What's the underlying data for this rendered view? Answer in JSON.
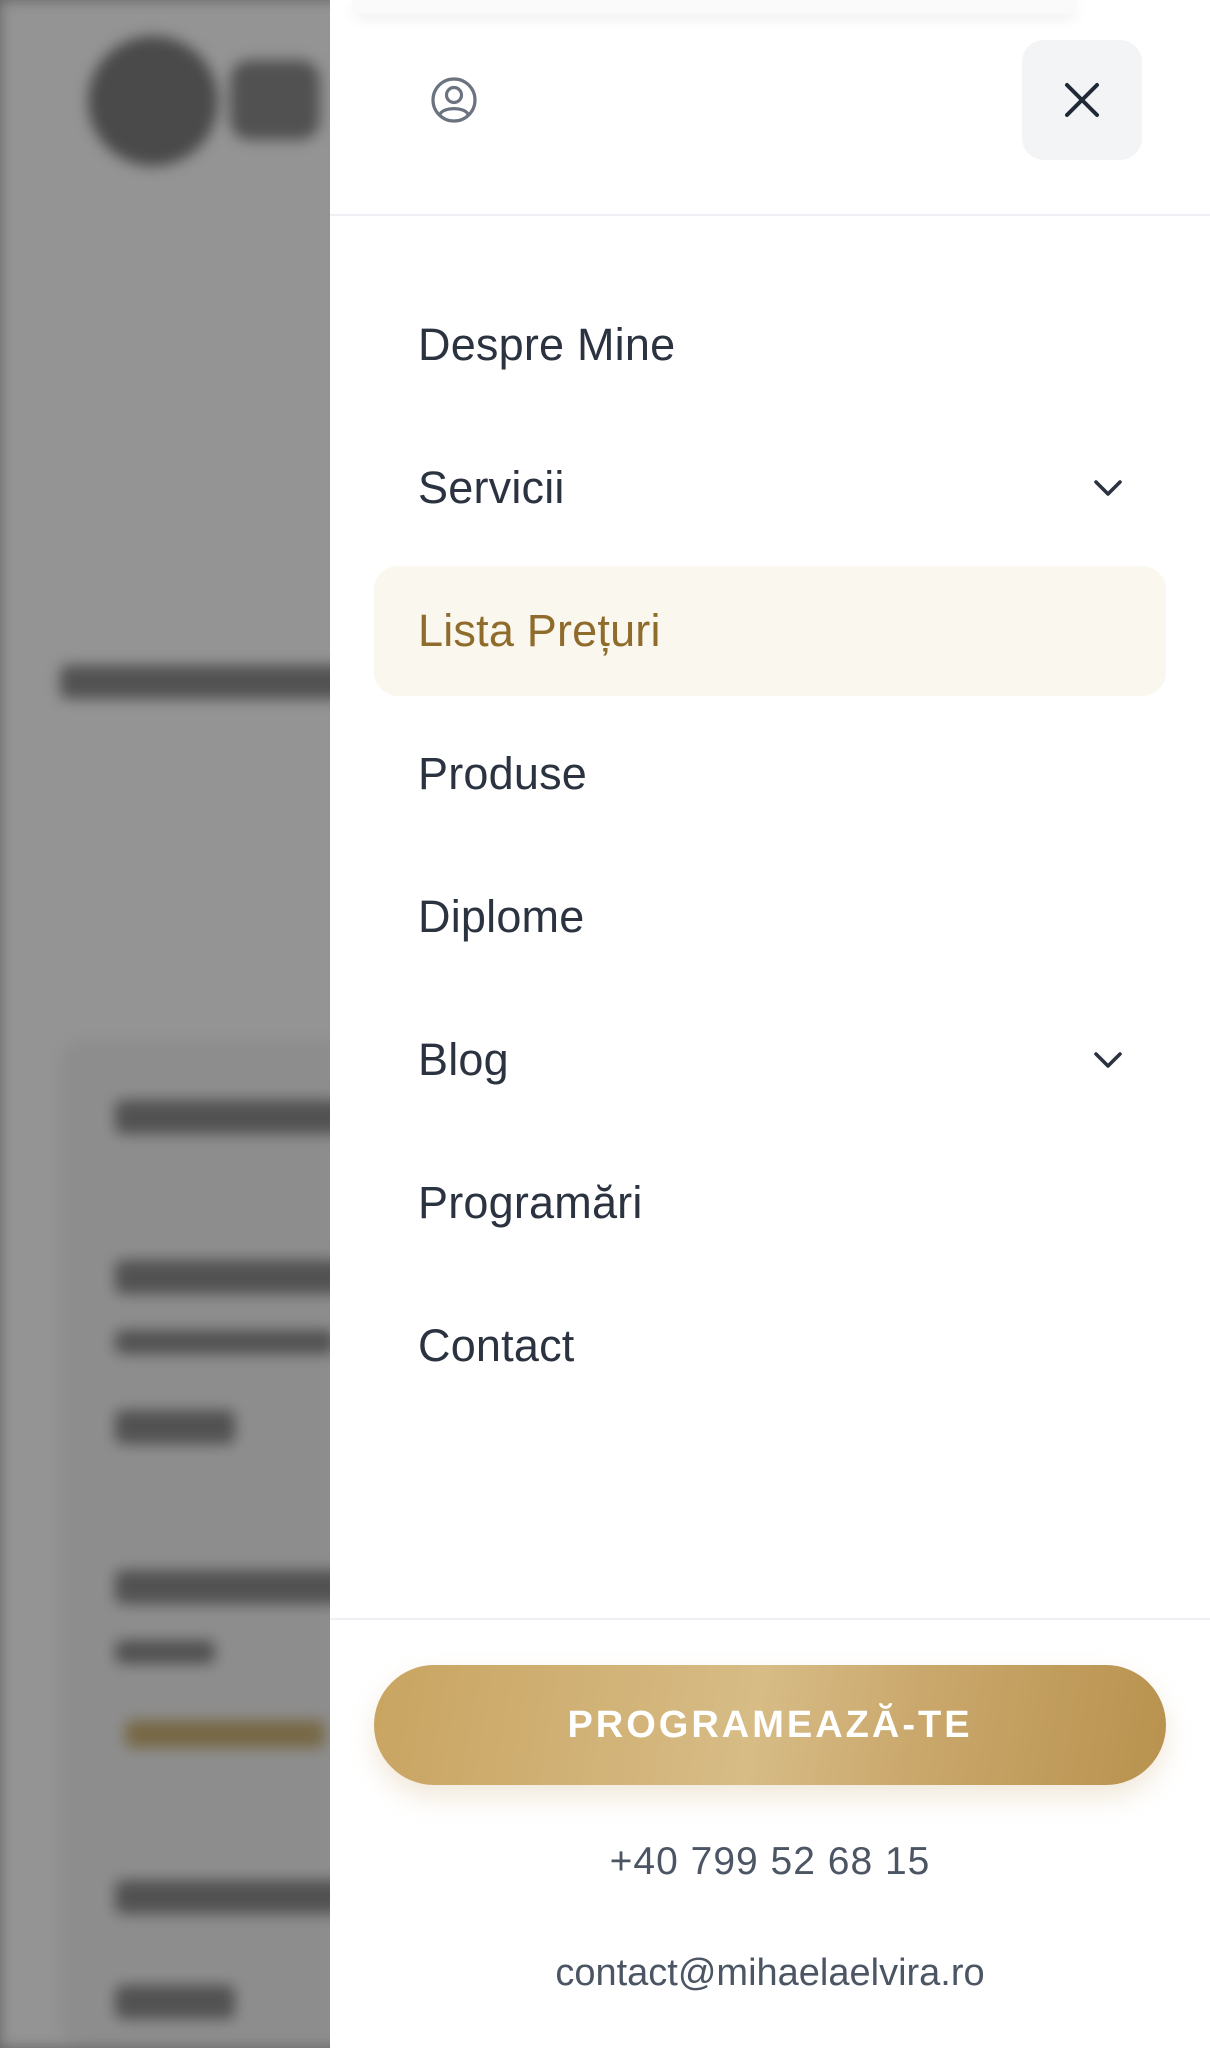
{
  "drawer": {
    "user_icon": "user-circle-icon",
    "close_icon": "close-icon",
    "nav_items": [
      {
        "label": "Despre Mine",
        "has_dropdown": false,
        "active": false
      },
      {
        "label": "Servicii",
        "has_dropdown": true,
        "active": false
      },
      {
        "label": "Lista Prețuri",
        "has_dropdown": false,
        "active": true
      },
      {
        "label": "Produse",
        "has_dropdown": false,
        "active": false
      },
      {
        "label": "Diplome",
        "has_dropdown": false,
        "active": false
      },
      {
        "label": "Blog",
        "has_dropdown": true,
        "active": false
      },
      {
        "label": "Programări",
        "has_dropdown": false,
        "active": false
      },
      {
        "label": "Contact",
        "has_dropdown": false,
        "active": false
      }
    ],
    "cta_label": "PROGRAMEAZĂ-TE",
    "phone": "+40 799 52 68 15",
    "email": "contact@mihaelaelvira.ro"
  },
  "colors": {
    "accent_gold": "#c9a461",
    "active_bg": "#faf7ee",
    "active_text": "#8f6b2c",
    "nav_text": "#2b3240"
  }
}
